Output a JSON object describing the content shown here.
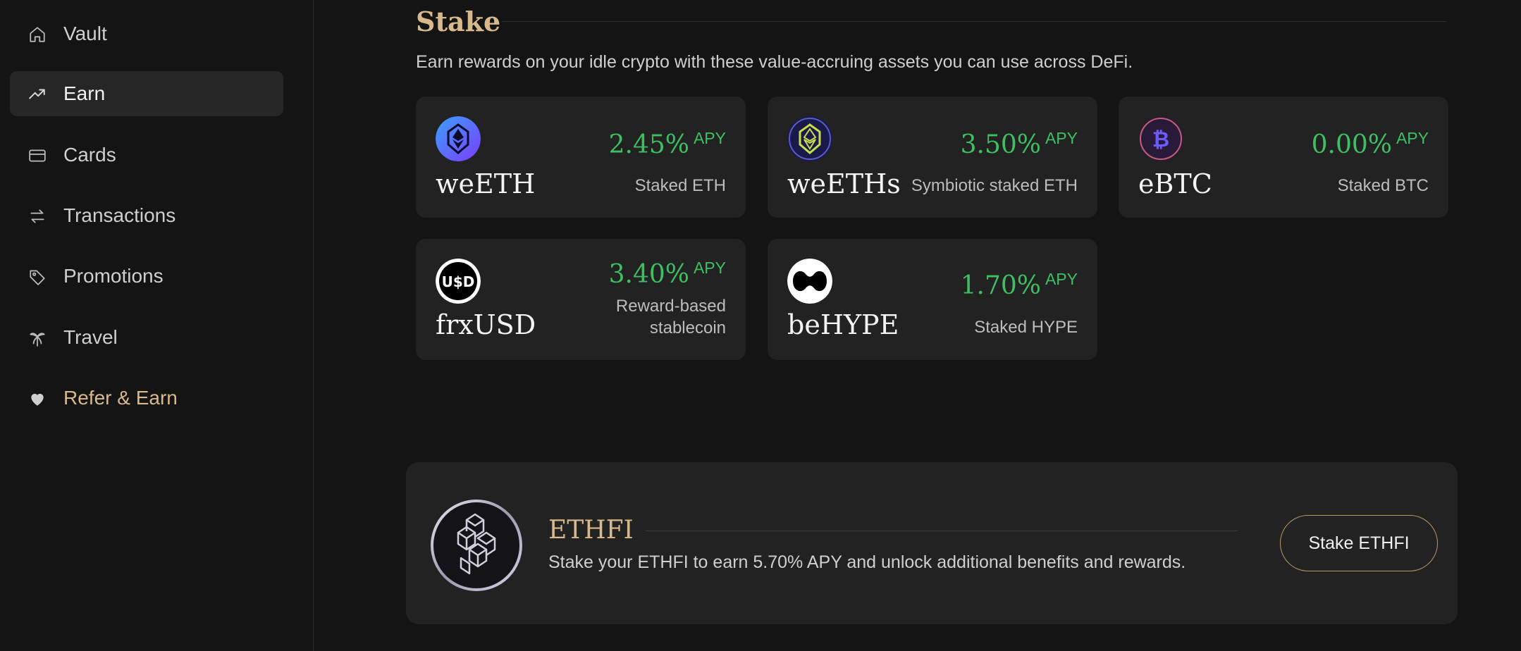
{
  "sidebar": {
    "items": [
      {
        "label": "Vault",
        "icon": "home-icon"
      },
      {
        "label": "Earn",
        "icon": "trending-up-icon"
      },
      {
        "label": "Cards",
        "icon": "credit-card-icon"
      },
      {
        "label": "Transactions",
        "icon": "arrows-swap-icon"
      },
      {
        "label": "Promotions",
        "icon": "tag-icon"
      },
      {
        "label": "Travel",
        "icon": "palm-tree-icon"
      },
      {
        "label": "Refer & Earn",
        "icon": "heart-icon"
      }
    ],
    "active": "Earn"
  },
  "stake": {
    "title": "Stake",
    "subtitle": "Earn rewards on your idle crypto with these value-accruing assets you can use across DeFi.",
    "cards": [
      {
        "name": "weETH",
        "apy": "2.45%",
        "apy_unit": "APY",
        "desc": "Staked ETH",
        "icon": "weeth-logo-icon"
      },
      {
        "name": "weETHs",
        "apy": "3.50%",
        "apy_unit": "APY",
        "desc": "Symbiotic staked ETH",
        "icon": "weeths-logo-icon"
      },
      {
        "name": "eBTC",
        "apy": "0.00%",
        "apy_unit": "APY",
        "desc": "Staked BTC",
        "icon": "ebtc-logo-icon"
      },
      {
        "name": "frxUSD",
        "apy": "3.40%",
        "apy_unit": "APY",
        "desc_line1": "Reward-based",
        "desc_line2": "stablecoin",
        "icon": "frxusd-logo-icon",
        "logo_text": "U$D"
      },
      {
        "name": "beHYPE",
        "apy": "1.70%",
        "apy_unit": "APY",
        "desc": "Staked HYPE",
        "icon": "behype-logo-icon"
      }
    ]
  },
  "ethfi": {
    "title": "ETHFI",
    "description": "Stake your ETHFI to earn 5.70% APY and unlock additional benefits and rewards.",
    "button_label": "Stake ETHFI",
    "icon": "ethfi-logo-icon"
  },
  "colors": {
    "background": "#141414",
    "card": "#222222",
    "accent_gold": "#d7b98c",
    "apy_green": "#3fbf63"
  }
}
